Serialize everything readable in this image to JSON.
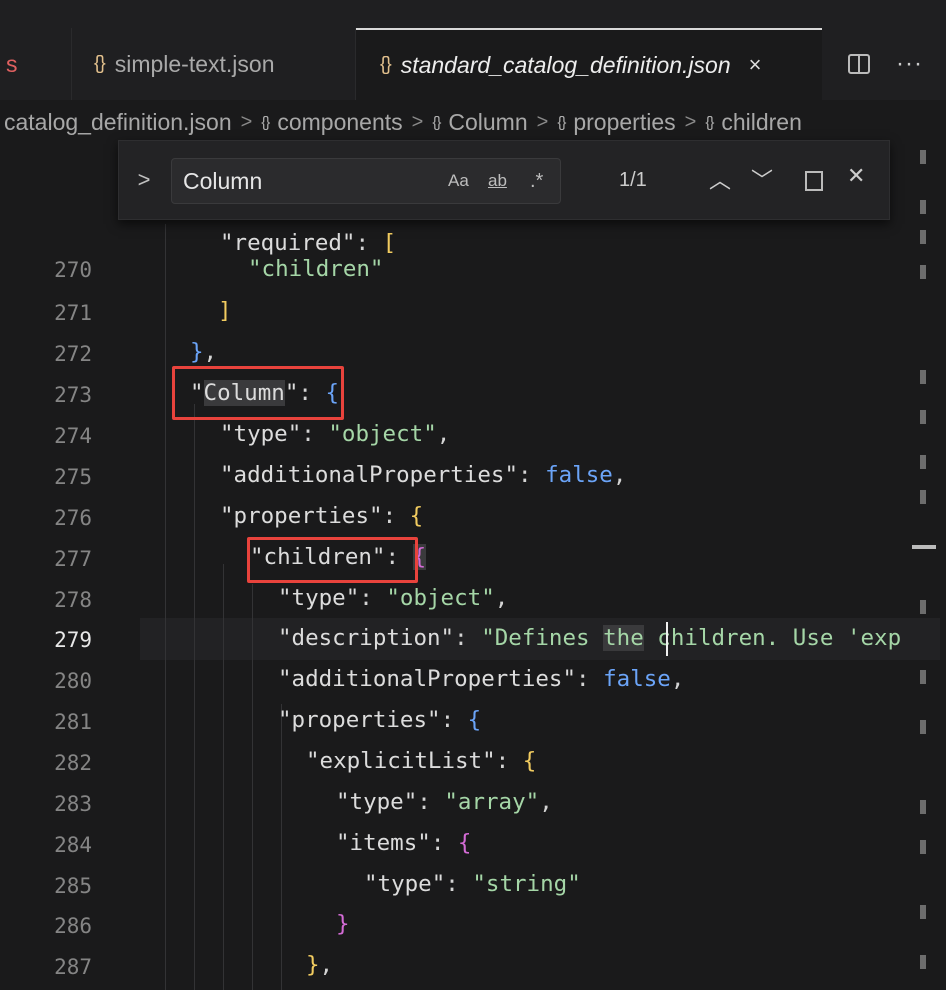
{
  "tabs": {
    "partial_label": "s",
    "simple_icon": "{}",
    "simple_label": "simple-text.json",
    "active_icon": "{}",
    "active_label": "standard_catalog_definition.json",
    "close_glyph": "×",
    "more_glyph": "···"
  },
  "breadcrumb": {
    "file": "catalog_definition.json",
    "items": [
      "components",
      "Column",
      "properties",
      "children"
    ],
    "icon": "{}",
    "separator": ">"
  },
  "find": {
    "toggle_glyph": ">",
    "query": "Column",
    "opt_case": "Aa",
    "opt_word": "ab",
    "opt_regex": ".*",
    "count": "1/1",
    "prev_glyph": "︿",
    "next_glyph": "﹀",
    "close_glyph": "✕"
  },
  "gutter": [
    "270",
    "271",
    "272",
    "273",
    "274",
    "275",
    "276",
    "277",
    "278",
    "279",
    "280",
    "281",
    "282",
    "283",
    "284",
    "285",
    "286",
    "287"
  ],
  "code": {
    "l_required_key": "\"required\"",
    "l_required_rest": ": ",
    "l_required_br": "[",
    "l270": "\"children\"",
    "l271": "]",
    "l272_br": "}",
    "l272_comma": ",",
    "l273_q1": "\"",
    "l273_key": "Column",
    "l273_q2": "\"",
    "l273_colon": ": ",
    "l273_br": "{",
    "l274_key": "\"type\"",
    "l274_colon": ": ",
    "l274_val": "\"object\"",
    "l274_comma": ",",
    "l275_key": "\"additionalProperties\"",
    "l275_colon": ": ",
    "l275_val": "false",
    "l275_comma": ",",
    "l276_key": "\"properties\"",
    "l276_colon": ": ",
    "l276_br": "{",
    "l277_key": "\"children\"",
    "l277_colon": ": ",
    "l277_br": "{",
    "l278_key": "\"type\"",
    "l278_colon": ": ",
    "l278_val": "\"object\"",
    "l278_comma": ",",
    "l279_key": "\"description\"",
    "l279_colon": ": ",
    "l279_val1": "\"Defines ",
    "l279_hl": "the",
    "l279_val2": " children. Use 'exp",
    "l280_key": "\"additionalProperties\"",
    "l280_colon": ": ",
    "l280_val": "false",
    "l280_comma": ",",
    "l281_key": "\"properties\"",
    "l281_colon": ": ",
    "l281_br": "{",
    "l282_key": "\"explicitList\"",
    "l282_colon": ": ",
    "l282_br": "{",
    "l283_key": "\"type\"",
    "l283_colon": ": ",
    "l283_val": "\"array\"",
    "l283_comma": ",",
    "l284_key": "\"items\"",
    "l284_colon": ": ",
    "l284_br": "{",
    "l285_key": "\"type\"",
    "l285_colon": ": ",
    "l285_val": "\"string\"",
    "l286_br": "}",
    "l287_br": "}",
    "l287_comma": ","
  },
  "colors": {
    "key": "#dcdcdc",
    "string": "#a5d6a7",
    "keyword": "#6ba4f8",
    "brace_yellow": "#f2cc60",
    "brace_magenta": "#d46bd6",
    "highlight_box": "#e8433c"
  }
}
